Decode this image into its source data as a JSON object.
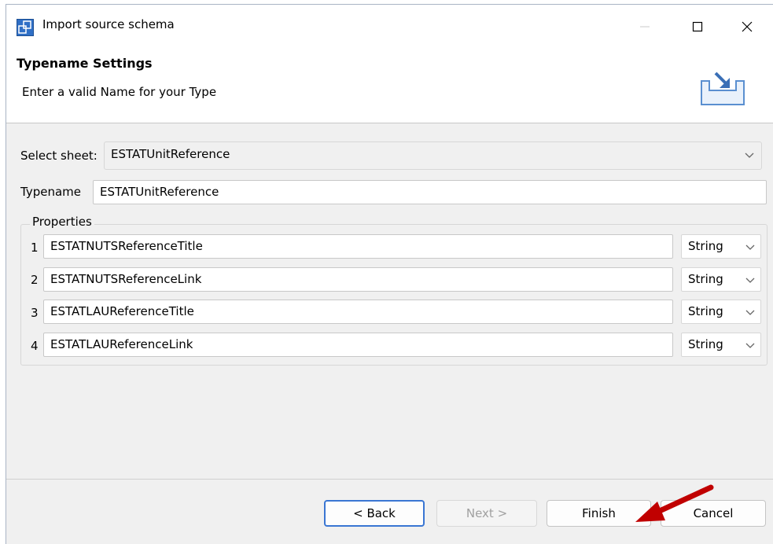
{
  "window": {
    "title": "Import source schema"
  },
  "banner": {
    "title": "Typename Settings",
    "subtitle": "Enter a valid Name for your Type"
  },
  "form": {
    "select_sheet_label": "Select sheet:",
    "select_sheet_value": "ESTATUnitReference",
    "typename_label": "Typename",
    "typename_value": "ESTATUnitReference",
    "properties_label": "Properties",
    "properties": [
      {
        "num": "1",
        "name": "ESTATNUTSReferenceTitle",
        "type": "String"
      },
      {
        "num": "2",
        "name": "ESTATNUTSReferenceLink",
        "type": "String"
      },
      {
        "num": "3",
        "name": "ESTATLAUReferenceTitle",
        "type": "String"
      },
      {
        "num": "4",
        "name": "ESTATLAUReferenceLink",
        "type": "String"
      }
    ]
  },
  "buttons": {
    "back": "< Back",
    "next": "Next >",
    "finish": "Finish",
    "cancel": "Cancel"
  },
  "colors": {
    "annotation_arrow": "#c00000",
    "focus_border": "#3a76d3"
  }
}
